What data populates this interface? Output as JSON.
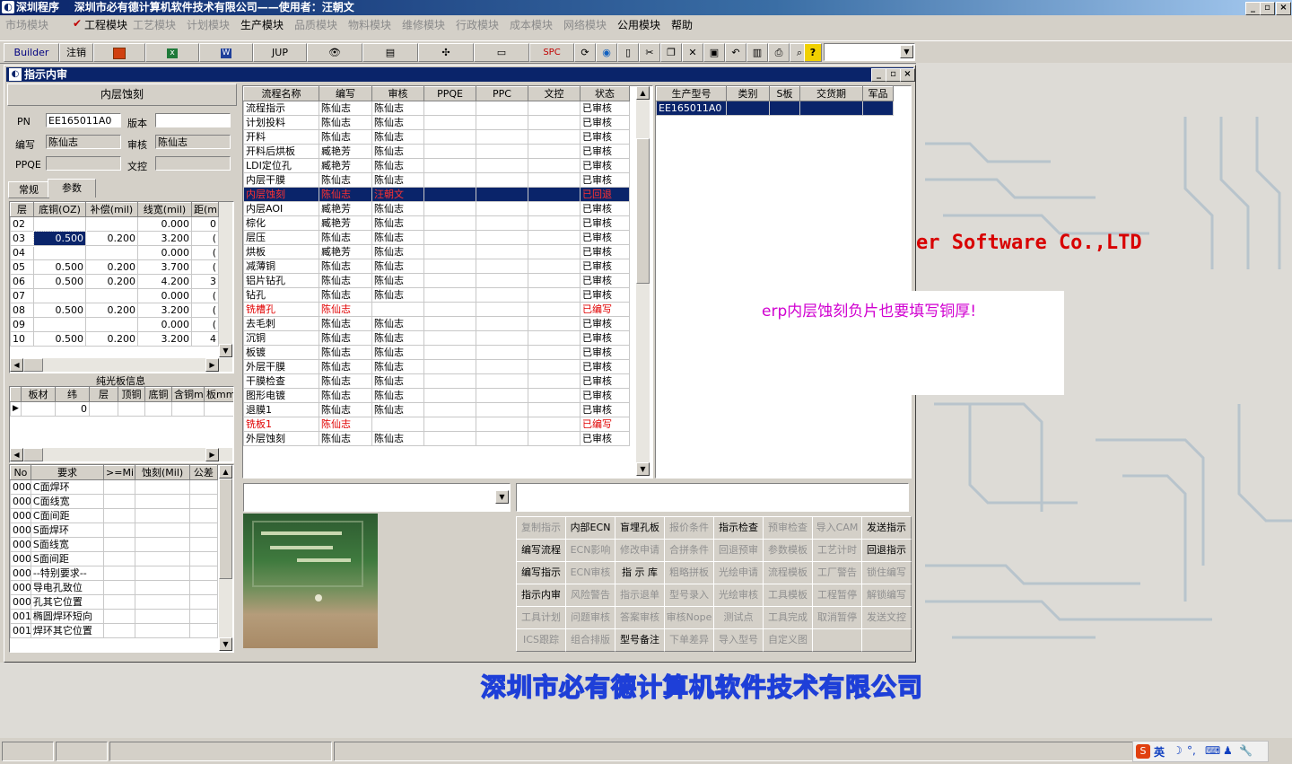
{
  "window": {
    "title": "深圳程序    深圳市必有德计算机软件技术有限公司——使用者：汪朝文"
  },
  "menu": [
    {
      "label": "市场模块",
      "enabled": false
    },
    {
      "label": "工程模块",
      "enabled": true,
      "checked": true
    },
    {
      "label": "工艺模块",
      "enabled": false
    },
    {
      "label": "计划模块",
      "enabled": false
    },
    {
      "label": "生产模块",
      "enabled": true
    },
    {
      "label": "品质模块",
      "enabled": false
    },
    {
      "label": "物料模块",
      "enabled": false
    },
    {
      "label": "维修模块",
      "enabled": false
    },
    {
      "label": "行政模块",
      "enabled": false
    },
    {
      "label": "成本模块",
      "enabled": false
    },
    {
      "label": "网络模块",
      "enabled": false
    },
    {
      "label": "公用模块",
      "enabled": true
    },
    {
      "label": "帮助",
      "enabled": true
    }
  ],
  "toolbar": {
    "builder": "Builder",
    "logout": "注销",
    "jup": "JUP",
    "spc": "SPC",
    "help": "?"
  },
  "child": {
    "title": "指示内审"
  },
  "left": {
    "heading": "内层蚀刻",
    "pn_label": "PN",
    "pn": "EE165011A0",
    "version_label": "版本",
    "version": "",
    "author_label": "编写",
    "author": "陈仙志",
    "review_label": "审核",
    "reviewer": "陈仙志",
    "ppqe_label": "PPQE",
    "ppqe": "",
    "docreview_label": "文控",
    "docreview": "",
    "tabs": [
      "常规",
      "参数"
    ],
    "param_headers": [
      "层",
      "底铜(OZ)",
      "补偿(mil)",
      "线宽(mil)",
      "距(mi"
    ],
    "params": [
      [
        "02",
        "",
        "",
        "0.000",
        "0"
      ],
      [
        "03",
        "0.500",
        "0.200",
        "3.200",
        "("
      ],
      [
        "04",
        "",
        "",
        "0.000",
        "("
      ],
      [
        "05",
        "0.500",
        "0.200",
        "3.700",
        "("
      ],
      [
        "06",
        "0.500",
        "0.200",
        "4.200",
        "3"
      ],
      [
        "07",
        "",
        "",
        "0.000",
        "("
      ],
      [
        "08",
        "0.500",
        "0.200",
        "3.200",
        "("
      ],
      [
        "09",
        "",
        "",
        "0.000",
        "("
      ],
      [
        "10",
        "0.500",
        "0.200",
        "3.200",
        "4"
      ]
    ],
    "bare_title": "纯光板信息",
    "bare_headers": [
      "板材",
      "纬",
      "层",
      "顶铜",
      "底铜",
      "含铜mm",
      "板mm"
    ],
    "bare_row": [
      "",
      "0",
      "",
      "",
      "",
      "",
      ""
    ],
    "req_headers": [
      "No",
      "要求",
      ">=Mil",
      "蚀刻(Mil)",
      "公差"
    ],
    "reqs": [
      [
        "000",
        "C面焊环"
      ],
      [
        "000",
        "C面线宽"
      ],
      [
        "000",
        "C面间距"
      ],
      [
        "000",
        "S面焊环"
      ],
      [
        "000",
        "S面线宽"
      ],
      [
        "000",
        "S面间距"
      ],
      [
        "000",
        "--特别要求--"
      ],
      [
        "000",
        "导电孔致位"
      ],
      [
        "000",
        "孔其它位置"
      ],
      [
        "001",
        "椭圆焊环短向"
      ],
      [
        "001",
        "焊环其它位置"
      ]
    ]
  },
  "process": {
    "headers": [
      "流程名称",
      "编写",
      "审核",
      "PPQE",
      "PPC",
      "文控",
      "状态"
    ],
    "rows": [
      [
        "流程指示",
        "陈仙志",
        "陈仙志",
        "",
        "",
        "",
        "已审核"
      ],
      [
        "计划投料",
        "陈仙志",
        "陈仙志",
        "",
        "",
        "",
        "已审核"
      ],
      [
        "开料",
        "陈仙志",
        "陈仙志",
        "",
        "",
        "",
        "已审核"
      ],
      [
        "开料后烘板",
        "臧艳芳",
        "陈仙志",
        "",
        "",
        "",
        "已审核"
      ],
      [
        "LDI定位孔",
        "臧艳芳",
        "陈仙志",
        "",
        "",
        "",
        "已审核"
      ],
      [
        "内层干膜",
        "陈仙志",
        "陈仙志",
        "",
        "",
        "",
        "已审核"
      ],
      [
        "内层蚀刻",
        "陈仙志",
        "汪朝文",
        "",
        "",
        "",
        "已回退"
      ],
      [
        "内层AOI",
        "臧艳芳",
        "陈仙志",
        "",
        "",
        "",
        "已审核"
      ],
      [
        "棕化",
        "臧艳芳",
        "陈仙志",
        "",
        "",
        "",
        "已审核"
      ],
      [
        "层压",
        "陈仙志",
        "陈仙志",
        "",
        "",
        "",
        "已审核"
      ],
      [
        "烘板",
        "臧艳芳",
        "陈仙志",
        "",
        "",
        "",
        "已审核"
      ],
      [
        "减薄铜",
        "陈仙志",
        "陈仙志",
        "",
        "",
        "",
        "已审核"
      ],
      [
        "铝片钻孔",
        "陈仙志",
        "陈仙志",
        "",
        "",
        "",
        "已审核"
      ],
      [
        "钻孔",
        "陈仙志",
        "陈仙志",
        "",
        "",
        "",
        "已审核"
      ],
      [
        "铣槽孔",
        "陈仙志",
        "",
        "",
        "",
        "",
        "已编写"
      ],
      [
        "去毛刺",
        "陈仙志",
        "陈仙志",
        "",
        "",
        "",
        "已审核"
      ],
      [
        "沉铜",
        "陈仙志",
        "陈仙志",
        "",
        "",
        "",
        "已审核"
      ],
      [
        "板镀",
        "陈仙志",
        "陈仙志",
        "",
        "",
        "",
        "已审核"
      ],
      [
        "外层干膜",
        "陈仙志",
        "陈仙志",
        "",
        "",
        "",
        "已审核"
      ],
      [
        "干膜检查",
        "陈仙志",
        "陈仙志",
        "",
        "",
        "",
        "已审核"
      ],
      [
        "图形电镀",
        "陈仙志",
        "陈仙志",
        "",
        "",
        "",
        "已审核"
      ],
      [
        "退膜1",
        "陈仙志",
        "陈仙志",
        "",
        "",
        "",
        "已审核"
      ],
      [
        "铣板1",
        "陈仙志",
        "",
        "",
        "",
        "",
        "已编写"
      ],
      [
        "外层蚀刻",
        "陈仙志",
        "陈仙志",
        "",
        "",
        "",
        "已审核"
      ]
    ],
    "selected_index": 6,
    "red_indices": [
      14,
      22
    ]
  },
  "models": {
    "headers": [
      "生产型号",
      "类别",
      "S板",
      "交货期",
      "军品"
    ],
    "rows": [
      [
        "EE165011A0",
        "",
        "",
        "",
        ""
      ]
    ]
  },
  "actions": [
    [
      {
        "l": "复制指示",
        "e": false
      },
      {
        "l": "内部ECN",
        "e": true
      },
      {
        "l": "盲埋孔板",
        "e": true
      },
      {
        "l": "报价条件",
        "e": false
      },
      {
        "l": "指示检查",
        "e": true
      },
      {
        "l": "预审检查",
        "e": false
      },
      {
        "l": "导入CAM",
        "e": false
      },
      {
        "l": "发送指示",
        "e": true
      }
    ],
    [
      {
        "l": "编写流程",
        "e": true
      },
      {
        "l": "ECN影响",
        "e": false
      },
      {
        "l": "修改申请",
        "e": false
      },
      {
        "l": "合拼条件",
        "e": false
      },
      {
        "l": "回退预审",
        "e": false
      },
      {
        "l": "参数模板",
        "e": false
      },
      {
        "l": "工艺计时",
        "e": false
      },
      {
        "l": "回退指示",
        "e": true
      }
    ],
    [
      {
        "l": "编写指示",
        "e": true
      },
      {
        "l": "ECN审核",
        "e": false
      },
      {
        "l": "指 示 库",
        "e": true
      },
      {
        "l": "粗略拼板",
        "e": false
      },
      {
        "l": "光绘申请",
        "e": false
      },
      {
        "l": "流程模板",
        "e": false
      },
      {
        "l": "工厂警告",
        "e": false
      },
      {
        "l": "锁住编写",
        "e": false
      }
    ],
    [
      {
        "l": "指示内审",
        "e": true
      },
      {
        "l": "风险警告",
        "e": false
      },
      {
        "l": "指示退单",
        "e": false
      },
      {
        "l": "型号录入",
        "e": false
      },
      {
        "l": "光绘审核",
        "e": false
      },
      {
        "l": "工具模板",
        "e": false
      },
      {
        "l": "工程暂停",
        "e": false
      },
      {
        "l": "解锁编写",
        "e": false
      }
    ],
    [
      {
        "l": "工具计划",
        "e": false
      },
      {
        "l": "问题审核",
        "e": false
      },
      {
        "l": "答案审核",
        "e": false
      },
      {
        "l": "审核Nope",
        "e": false
      },
      {
        "l": "测试点",
        "e": false
      },
      {
        "l": "工具完成",
        "e": false
      },
      {
        "l": "取消暂停",
        "e": false
      },
      {
        "l": "发送文控",
        "e": false
      }
    ],
    [
      {
        "l": "ICS跟踪",
        "e": false
      },
      {
        "l": "组合排版",
        "e": false
      },
      {
        "l": "型号备注",
        "e": true
      },
      {
        "l": "下单差异",
        "e": false
      },
      {
        "l": "导入型号",
        "e": false
      },
      {
        "l": "自定义图",
        "e": false
      },
      {
        "l": "",
        "e": false
      },
      {
        "l": "",
        "e": false
      }
    ]
  ],
  "background": {
    "software_text": "er Software Co.,LTD",
    "company_text": "深圳市必有德计算机软件技术有限公司"
  },
  "note": {
    "text": "erp内层蚀刻负片也要填写铜厚!"
  },
  "tray": {
    "ime": "英"
  }
}
